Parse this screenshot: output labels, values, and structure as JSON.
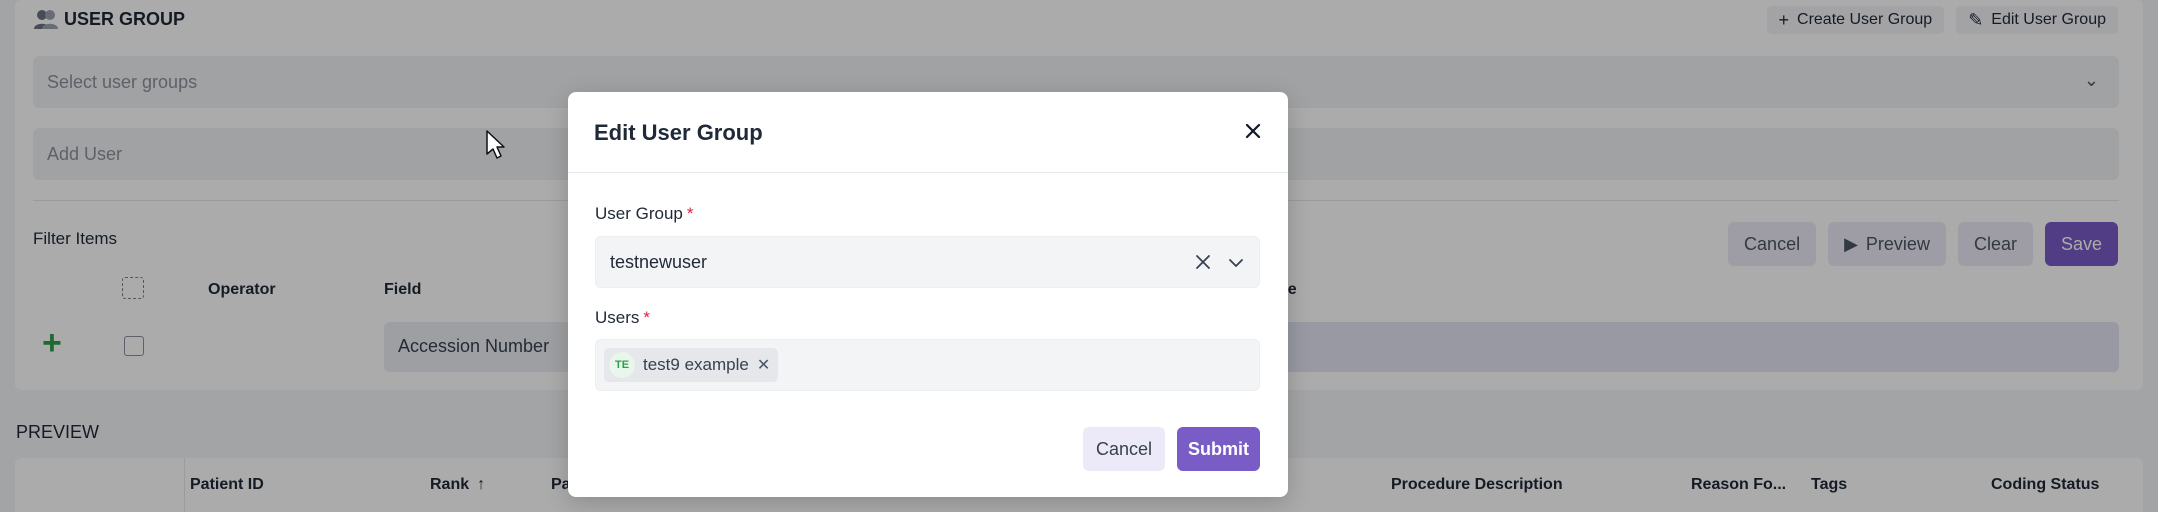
{
  "section": {
    "title": "USER GROUP",
    "icon": "users-icon",
    "actions": [
      {
        "label": "Create User Group",
        "icon": "plus-icon"
      },
      {
        "label": "Edit User Group",
        "icon": "edit-icon"
      }
    ]
  },
  "select_groups": {
    "placeholder": "Select user groups"
  },
  "add_user": {
    "placeholder": "Add User"
  },
  "filter": {
    "title": "Filter Items",
    "buttons": {
      "cancel": "Cancel",
      "preview": "Preview",
      "clear": "Clear",
      "save": "Save"
    },
    "columns": {
      "operator": "Operator",
      "field": "Field",
      "value": "ue"
    },
    "row": {
      "field_value": "Accession Number"
    }
  },
  "preview": {
    "title": "PREVIEW",
    "columns": [
      "Patient ID",
      "Rank",
      "Pa",
      "Procedure Description",
      "Reason Fo...",
      "Tags",
      "Coding Status"
    ]
  },
  "modal": {
    "title": "Edit User Group",
    "user_group_label": "User Group",
    "user_group_value": "testnewuser",
    "users_label": "Users",
    "required_mark": "*",
    "users": [
      {
        "initials": "TE",
        "name": "test9 example"
      }
    ],
    "cancel_label": "Cancel",
    "submit_label": "Submit"
  },
  "colors": {
    "accent": "#7a5cc7",
    "required": "#e11d48",
    "avatar_green": "#2e9e4b"
  }
}
